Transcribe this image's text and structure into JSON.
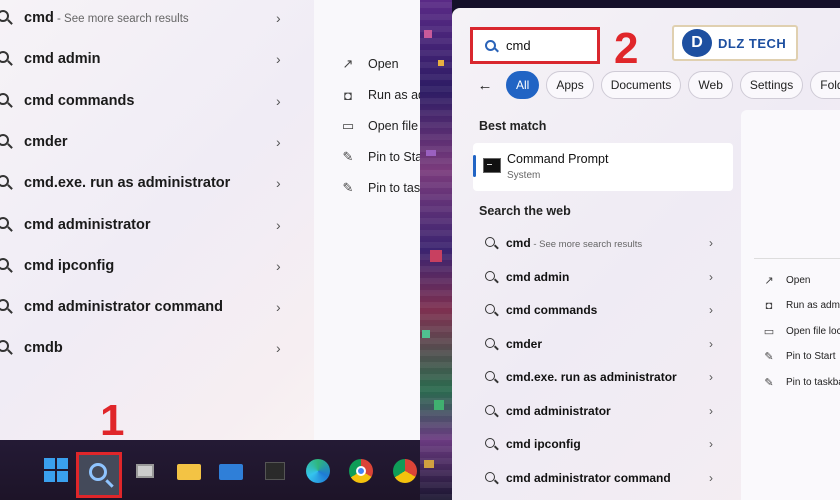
{
  "left_panel": {
    "results": [
      {
        "bold": "cmd",
        "sub": " - See more search results"
      },
      {
        "bold": "cmd admin",
        "sub": ""
      },
      {
        "bold": "cmd commands",
        "sub": ""
      },
      {
        "bold": "cmder",
        "sub": ""
      },
      {
        "bold": "cmd.exe. run as administrator",
        "sub": ""
      },
      {
        "bold": "cmd administrator",
        "sub": ""
      },
      {
        "bold": "cmd ipconfig",
        "sub": ""
      },
      {
        "bold": "cmd administrator command",
        "sub": ""
      },
      {
        "bold": "cmdb",
        "sub": ""
      }
    ],
    "actions": [
      {
        "icon": "open-icon",
        "label": "Open"
      },
      {
        "icon": "run-as-admin-icon",
        "label": "Run as ad"
      },
      {
        "icon": "folder-icon",
        "label": "Open file"
      },
      {
        "icon": "pin-icon",
        "label": "Pin to Sta"
      },
      {
        "icon": "pin-icon",
        "label": "Pin to tas"
      }
    ]
  },
  "annotations": {
    "step1": "1",
    "step2": "2"
  },
  "right_panel": {
    "search_value": "cmd",
    "logo_text": "DLZ TECH",
    "filters": [
      "All",
      "Apps",
      "Documents",
      "Web",
      "Settings",
      "Folders"
    ],
    "best_match_heading": "Best match",
    "best_match": {
      "name": "Command Prompt",
      "type": "System"
    },
    "web_heading": "Search the web",
    "web_results": [
      {
        "bold": "cmd",
        "sub": " - See more search results"
      },
      {
        "bold": "cmd admin",
        "sub": ""
      },
      {
        "bold": "cmd commands",
        "sub": ""
      },
      {
        "bold": "cmder",
        "sub": ""
      },
      {
        "bold": "cmd.exe. run as administrator",
        "sub": ""
      },
      {
        "bold": "cmd administrator",
        "sub": ""
      },
      {
        "bold": "cmd ipconfig",
        "sub": ""
      },
      {
        "bold": "cmd administrator command",
        "sub": ""
      }
    ],
    "actions": [
      {
        "icon": "open-icon",
        "label": "Open"
      },
      {
        "icon": "run-as-admin-icon",
        "label": "Run as admi"
      },
      {
        "icon": "folder-icon",
        "label": "Open file loc"
      },
      {
        "icon": "pin-icon",
        "label": "Pin to Start"
      },
      {
        "icon": "pin-icon",
        "label": "Pin to taskba"
      }
    ]
  },
  "colors": {
    "accent": "#2164c4",
    "highlight": "#e0262a"
  }
}
